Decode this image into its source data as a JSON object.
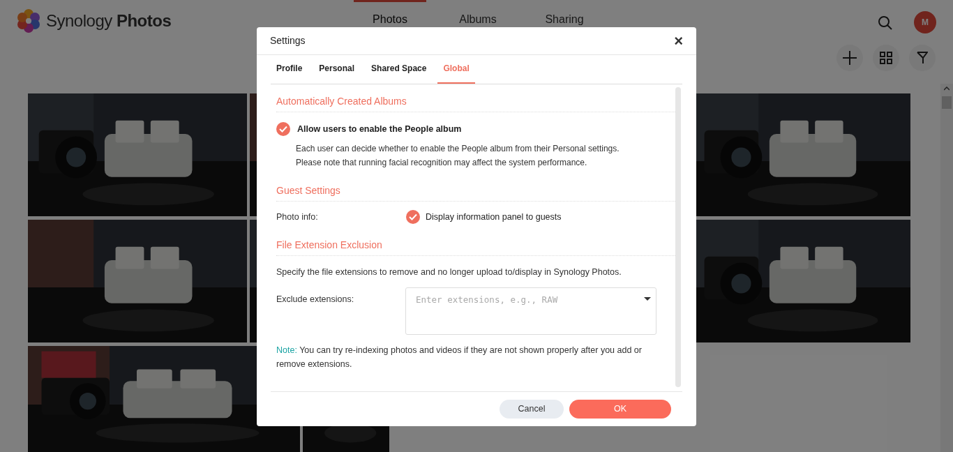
{
  "app": {
    "brand_light": "Synology",
    "brand_bold": "Photos",
    "avatar": "M"
  },
  "nav": [
    {
      "label": "Photos",
      "selected": true
    },
    {
      "label": "Albums",
      "selected": false
    },
    {
      "label": "Sharing",
      "selected": false
    }
  ],
  "dialog": {
    "title": "Settings",
    "close": "×",
    "tabs": [
      {
        "label": "Profile",
        "selected": false
      },
      {
        "label": "Personal",
        "selected": false
      },
      {
        "label": "Shared Space",
        "selected": false
      },
      {
        "label": "Global",
        "selected": true
      }
    ],
    "sections": [
      {
        "title": "Automatically Created Albums",
        "items": [
          {
            "kind": "checkbox",
            "label": "Allow users to enable the People album",
            "checked": true,
            "description": [
              "Each user can decide whether to enable the People album from their Personal settings.",
              "Please note that running facial recognition may affect the system performance."
            ]
          }
        ]
      },
      {
        "title": "Guest Settings",
        "items": [
          {
            "kind": "labeled_checkbox",
            "field_label": "Photo info:",
            "label": "Display information panel to guests",
            "checked": true
          }
        ]
      },
      {
        "title": "File Extension Exclusion",
        "items": [
          {
            "kind": "text",
            "text": "Specify the file extensions to remove and no longer upload to/display in Synology Photos."
          },
          {
            "kind": "select_field",
            "field_label": "Exclude extensions:",
            "placeholder": "Enter extensions, e.g., RAW"
          },
          {
            "kind": "note",
            "prefix": "Note:",
            "text": "You can try re-indexing photos and videos if they are not shown properly after you add or remove extensions."
          }
        ]
      }
    ],
    "buttons": [
      {
        "label": "Cancel",
        "kind": "secondary"
      },
      {
        "label": "OK",
        "kind": "primary"
      }
    ]
  }
}
